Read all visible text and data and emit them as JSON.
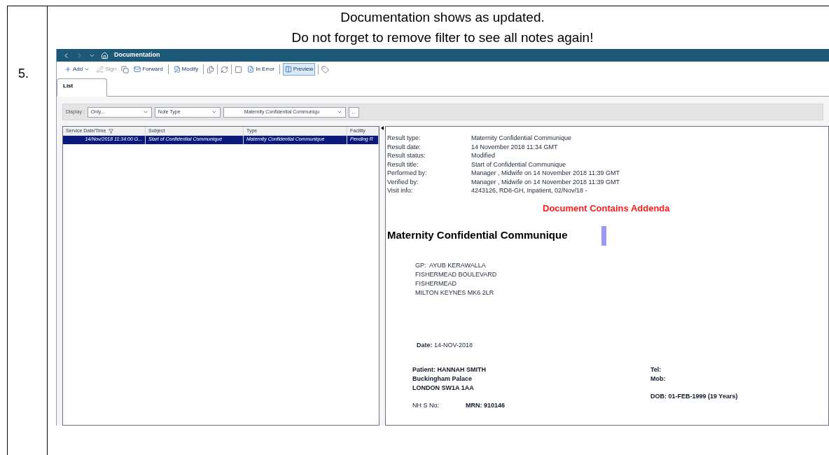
{
  "step": "5.",
  "heading": [
    "Documentation shows as updated.",
    "Do not forget to remove filter to see all notes again!"
  ],
  "app": {
    "title": "Documentation",
    "toolbar": [
      {
        "kind": "button",
        "label": "Add",
        "dropdown": true,
        "disabled": false,
        "selected": false
      },
      {
        "kind": "button",
        "label": "Sign",
        "dropdown": false,
        "disabled": true,
        "selected": false
      },
      {
        "kind": "icon"
      },
      {
        "kind": "button",
        "label": "Forward",
        "dropdown": false,
        "disabled": false,
        "selected": false
      },
      {
        "kind": "separator"
      },
      {
        "kind": "button",
        "label": "Modify",
        "dropdown": false,
        "disabled": false,
        "selected": false
      },
      {
        "kind": "separator"
      },
      {
        "kind": "icon"
      },
      {
        "kind": "separator"
      },
      {
        "kind": "icon"
      },
      {
        "kind": "separator"
      },
      {
        "kind": "icon"
      },
      {
        "kind": "button",
        "label": "In Error",
        "dropdown": false,
        "disabled": false,
        "selected": false
      },
      {
        "kind": "separator"
      },
      {
        "kind": "button",
        "label": "Preview",
        "dropdown": false,
        "disabled": false,
        "selected": true
      },
      {
        "kind": "separator"
      },
      {
        "kind": "icon"
      }
    ],
    "tabs": [
      {
        "label": "List",
        "selected": true
      }
    ],
    "filter": {
      "label": "Display :",
      "dropdowns": [
        "Only...",
        "Note Type",
        "Maternity Confidential Communiqu"
      ],
      "more_button": "..."
    },
    "table": {
      "columns": [
        "Service Date/Time",
        "Subject",
        "Type",
        "Facility"
      ],
      "rows": [
        {
          "selected": true,
          "cells": [
            "14/Nov/2018 11:34:00 G...",
            "Start of Confidential Communique",
            "Maternity Confidential Communique",
            "Pending R"
          ]
        }
      ]
    },
    "preview": {
      "fields": [
        {
          "label": "Result type:",
          "value": "Maternity Confidential Communique"
        },
        {
          "label": "Result date:",
          "value": "14 November 2018 11:34 GMT"
        },
        {
          "label": "Result status:",
          "value": "Modified"
        },
        {
          "label": "Result title:",
          "value": "Start of Confidential Communique"
        },
        {
          "label": "Performed by:",
          "value": "Manager , Midwife on 14 November 2018 11:39 GMT"
        },
        {
          "label": "Verified by:",
          "value": "Manager , Midwife on 14 November 2018 11:39 GMT"
        },
        {
          "label": "Visit info:",
          "value": "4243126, RD8-GH, Inpatient, 02/Nov/18 -"
        }
      ],
      "notice": "Document Contains Addenda",
      "document_title": "Maternity Confidential Communique",
      "gp_address": [
        "GP:  AYUB KERAWALLA",
        "FISHERMEAD BOULEVARD",
        "FISHERMEAD",
        "MILTON KEYNES MK6 2LR"
      ],
      "date": "**Date:** 14-NOV-2018",
      "patient": [
        "Patient: HANNAH SMITH",
        "Buckingham Palace",
        "LONDON SW1A 1AA"
      ],
      "nhs_label": "NH S No:",
      "mrn": "MRN: 910146",
      "contact": [
        "Tel:",
        "Mob:"
      ],
      "dob": "DOB: 01-FEB-1999 (19 Years)"
    }
  }
}
